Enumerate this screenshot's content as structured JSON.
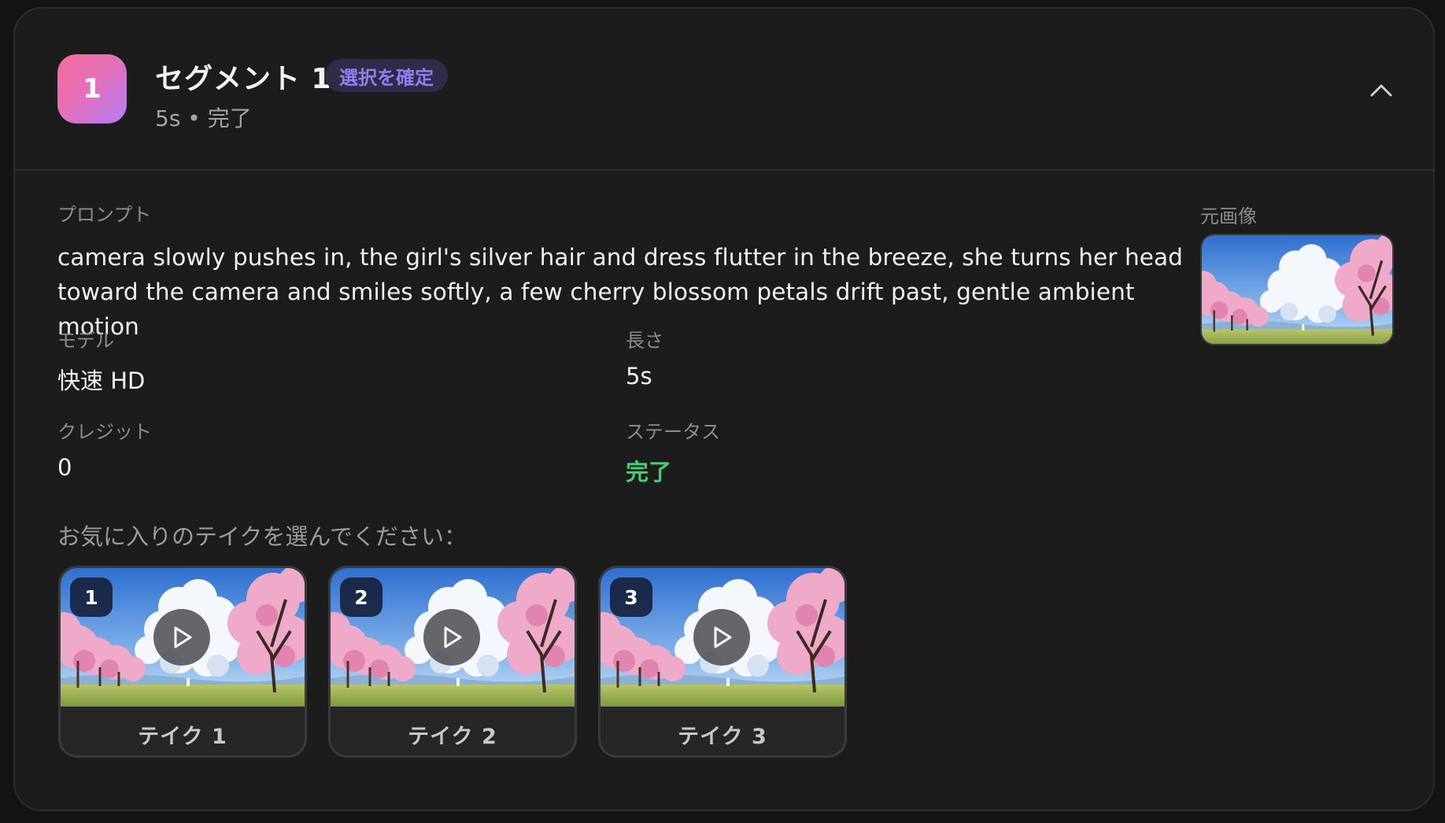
{
  "segment": {
    "number": "1",
    "title": "セグメント 1",
    "confirm_label": "選択を確定",
    "subtitle": "5s • 完了"
  },
  "details": {
    "prompt_label": "プロンプト",
    "prompt_text": "camera slowly pushes in, the girl's silver hair and dress flutter in the breeze, she turns her head toward the camera and smiles softly, a few cherry blossom petals drift past, gentle ambient motion",
    "source_image_label": "元画像",
    "model_label": "モデル",
    "model_value": "快速 HD",
    "length_label": "長さ",
    "length_value": "5s",
    "credits_label": "クレジット",
    "credits_value": "0",
    "status_label": "ステータス",
    "status_value": "完了"
  },
  "takes": {
    "prompt": "お気に入りのテイクを選んでください：",
    "items": [
      {
        "number": "1",
        "label": "テイク 1"
      },
      {
        "number": "2",
        "label": "テイク 2"
      },
      {
        "number": "3",
        "label": "テイク 3"
      }
    ]
  },
  "colors": {
    "accent_purple": "#8e7ff0",
    "status_green": "#3fd071",
    "badge_gradient_start": "#f36d9a",
    "badge_gradient_end": "#b47cf5"
  },
  "icons": {
    "collapse": "chevron-up-icon",
    "play": "play-icon"
  }
}
